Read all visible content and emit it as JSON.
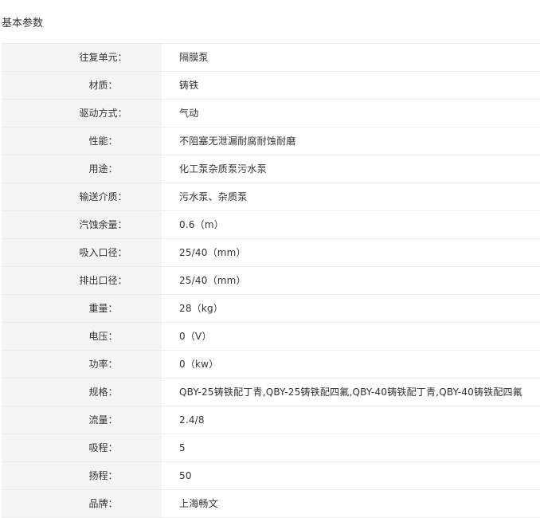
{
  "section": {
    "title": "基本参数"
  },
  "params": [
    {
      "label": "往复单元：",
      "value": "隔膜泵"
    },
    {
      "label": "材质：",
      "value": "铸铁"
    },
    {
      "label": "驱动方式：",
      "value": "气动"
    },
    {
      "label": "性能：",
      "value": "不阻塞无泄漏耐腐耐蚀耐磨"
    },
    {
      "label": "用途：",
      "value": "化工泵杂质泵污水泵"
    },
    {
      "label": "输送介质：",
      "value": "污水泵、杂质泵"
    },
    {
      "label": "汽蚀余量：",
      "value": "0.6（m）"
    },
    {
      "label": "吸入口径：",
      "value": "25/40（mm）"
    },
    {
      "label": "排出口径：",
      "value": "25/40（mm）"
    },
    {
      "label": "重量：",
      "value": "28（kg）"
    },
    {
      "label": "电压：",
      "value": "0（V）"
    },
    {
      "label": "功率：",
      "value": "0（kw）"
    },
    {
      "label": "规格：",
      "value": "QBY-25铸铁配丁青,QBY-25铸铁配四氟,QBY-40铸铁配丁青,QBY-40铸铁配四氟"
    },
    {
      "label": "流量：",
      "value": "2.4/8"
    },
    {
      "label": "吸程：",
      "value": "5"
    },
    {
      "label": "扬程：",
      "value": "50"
    },
    {
      "label": "品牌：",
      "value": "上海畅文"
    }
  ]
}
